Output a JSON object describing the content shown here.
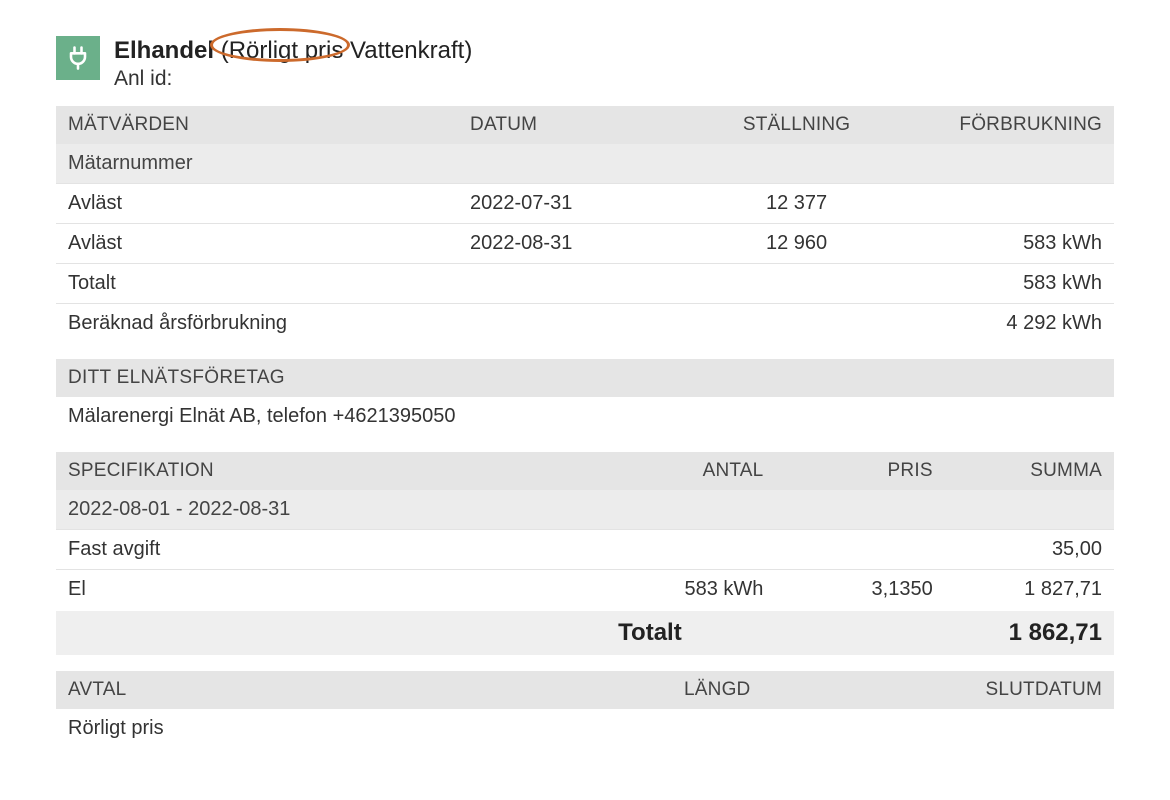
{
  "header": {
    "title_bold": "Elhandel",
    "title_rest": " (Rörligt pris Vattenkraft)",
    "subtitle": "Anl id:"
  },
  "metered": {
    "cols": [
      "MÄTVÄRDEN",
      "DATUM",
      "STÄLLNING",
      "FÖRBRUKNING"
    ],
    "subhead": "Mätarnummer",
    "rows": [
      {
        "label": "Avläst",
        "date": "2022-07-31",
        "reading": "12 377",
        "usage": ""
      },
      {
        "label": "Avläst",
        "date": "2022-08-31",
        "reading": "12 960",
        "usage": "583 kWh"
      },
      {
        "label": "Totalt",
        "date": "",
        "reading": "",
        "usage": "583 kWh"
      },
      {
        "label": "Beräknad årsförbrukning",
        "date": "",
        "reading": "",
        "usage": "4 292 kWh"
      }
    ]
  },
  "company": {
    "header": "DITT ELNÄTSFÖRETAG",
    "value": "Mälarenergi Elnät AB, telefon +4621395050"
  },
  "spec": {
    "cols": [
      "SPECIFIKATION",
      "ANTAL",
      "PRIS",
      "SUMMA"
    ],
    "period": "2022-08-01 - 2022-08-31",
    "rows": [
      {
        "label": "Fast avgift",
        "qty": "",
        "price": "",
        "sum": "35,00"
      },
      {
        "label": "El",
        "qty": "583 kWh",
        "price": "3,1350",
        "sum": "1 827,71"
      }
    ],
    "total_label": "Totalt",
    "total_value": "1 862,71"
  },
  "contract": {
    "cols": [
      "AVTAL",
      "LÄNGD",
      "SLUTDATUM"
    ],
    "row": {
      "label": "Rörligt pris",
      "length": "",
      "end": ""
    }
  }
}
